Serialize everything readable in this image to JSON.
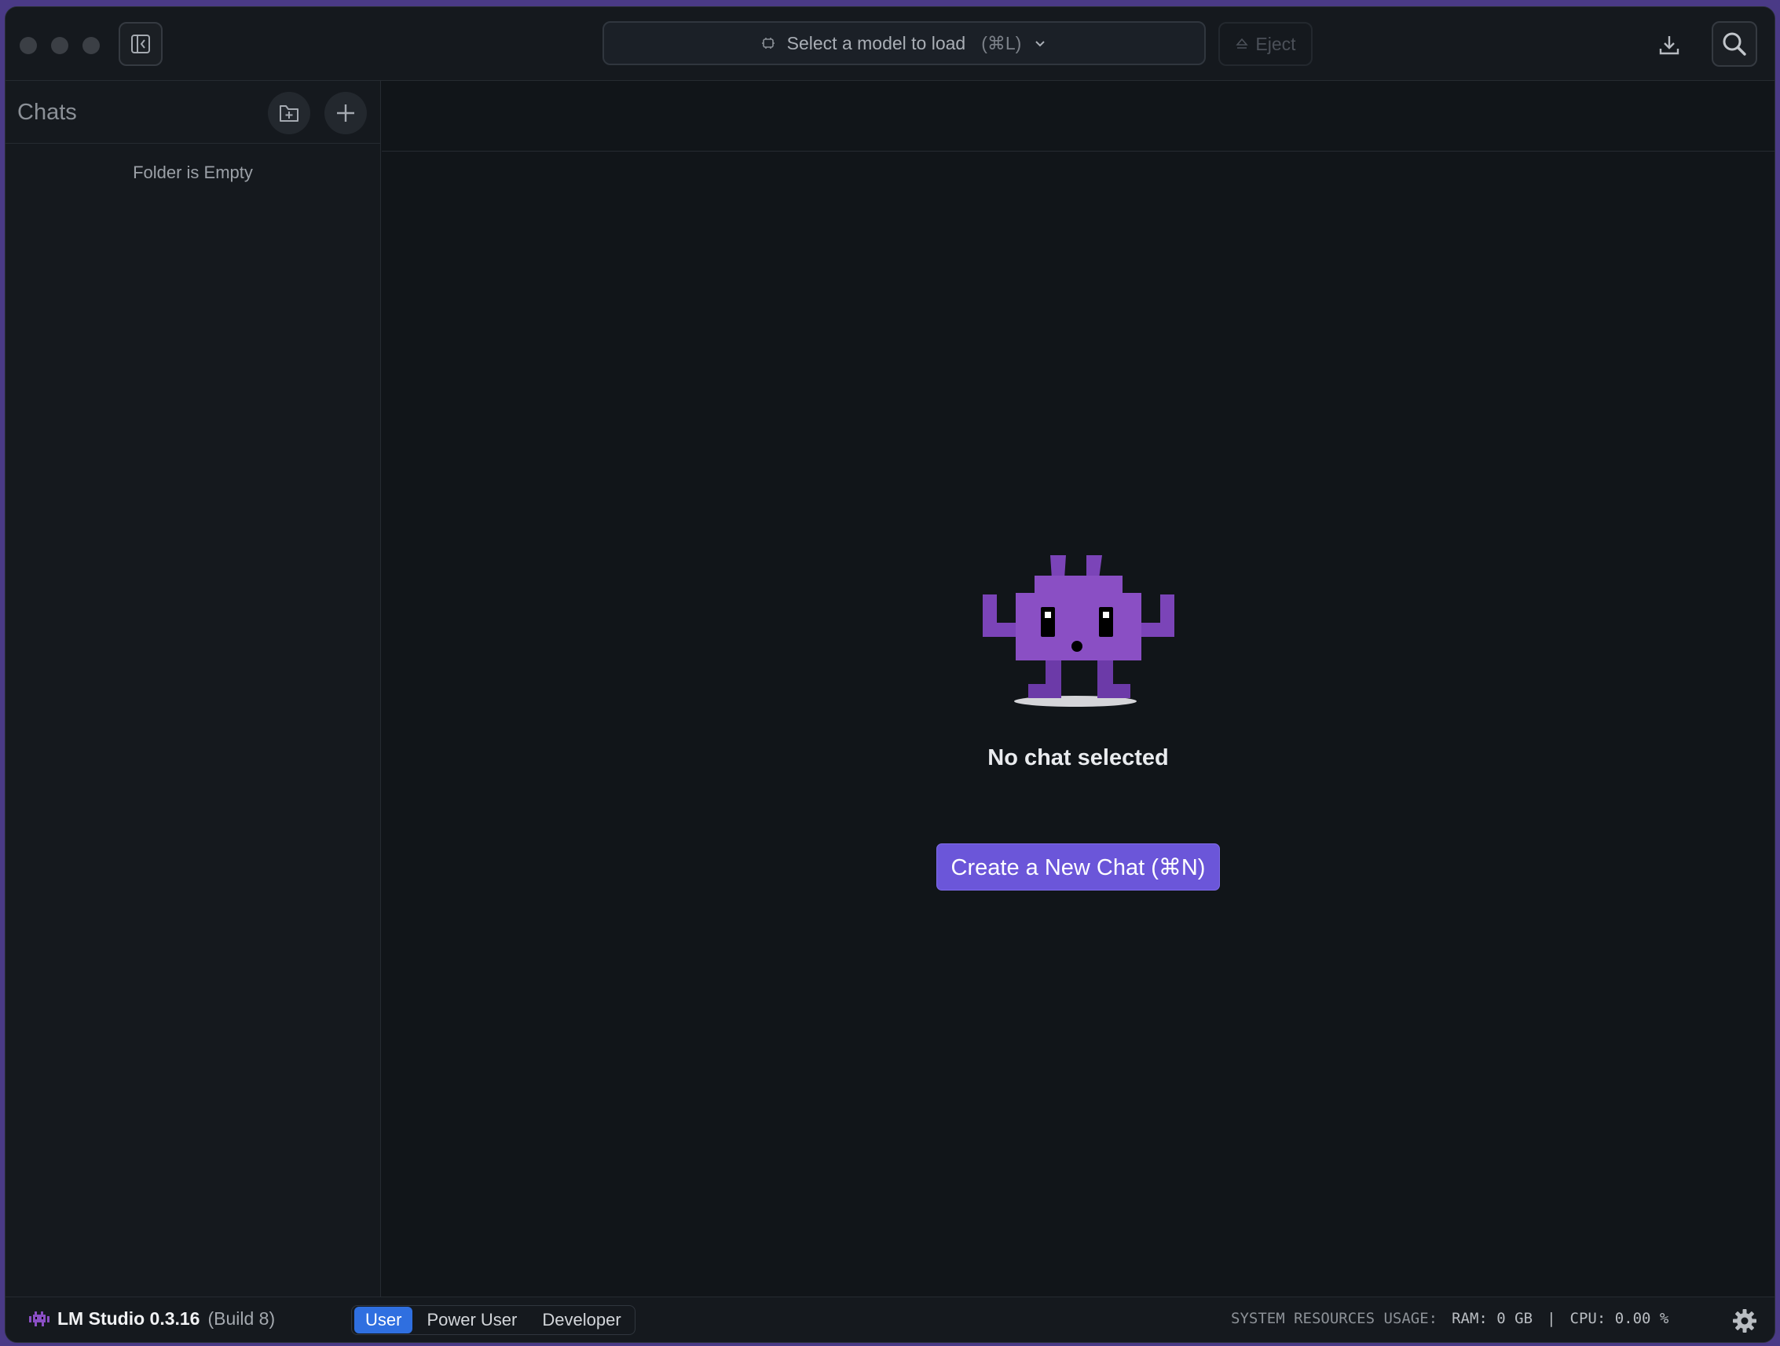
{
  "titlebar": {
    "model_select": {
      "label": "Select a model to load",
      "shortcut": "(⌘L)"
    },
    "eject_label": "Eject"
  },
  "sidebar": {
    "title": "Chats",
    "empty_text": "Folder is Empty"
  },
  "main": {
    "empty_title": "No chat selected",
    "create_button": "Create a New Chat (⌘N)"
  },
  "statusbar": {
    "app_name": "LM Studio 0.3.16",
    "build": "(Build 8)",
    "modes": [
      {
        "label": "User",
        "active": true
      },
      {
        "label": "Power User",
        "active": false
      },
      {
        "label": "Developer",
        "active": false
      }
    ],
    "resources_label": "SYSTEM RESOURCES USAGE:",
    "ram": "RAM: 0 GB",
    "separator": "|",
    "cpu": "CPU: 0.00 %"
  },
  "colors": {
    "accent": "#6b56d9",
    "mode_active": "#2f6fe0",
    "mascot": "#8a4fc4",
    "background": "#111519"
  }
}
